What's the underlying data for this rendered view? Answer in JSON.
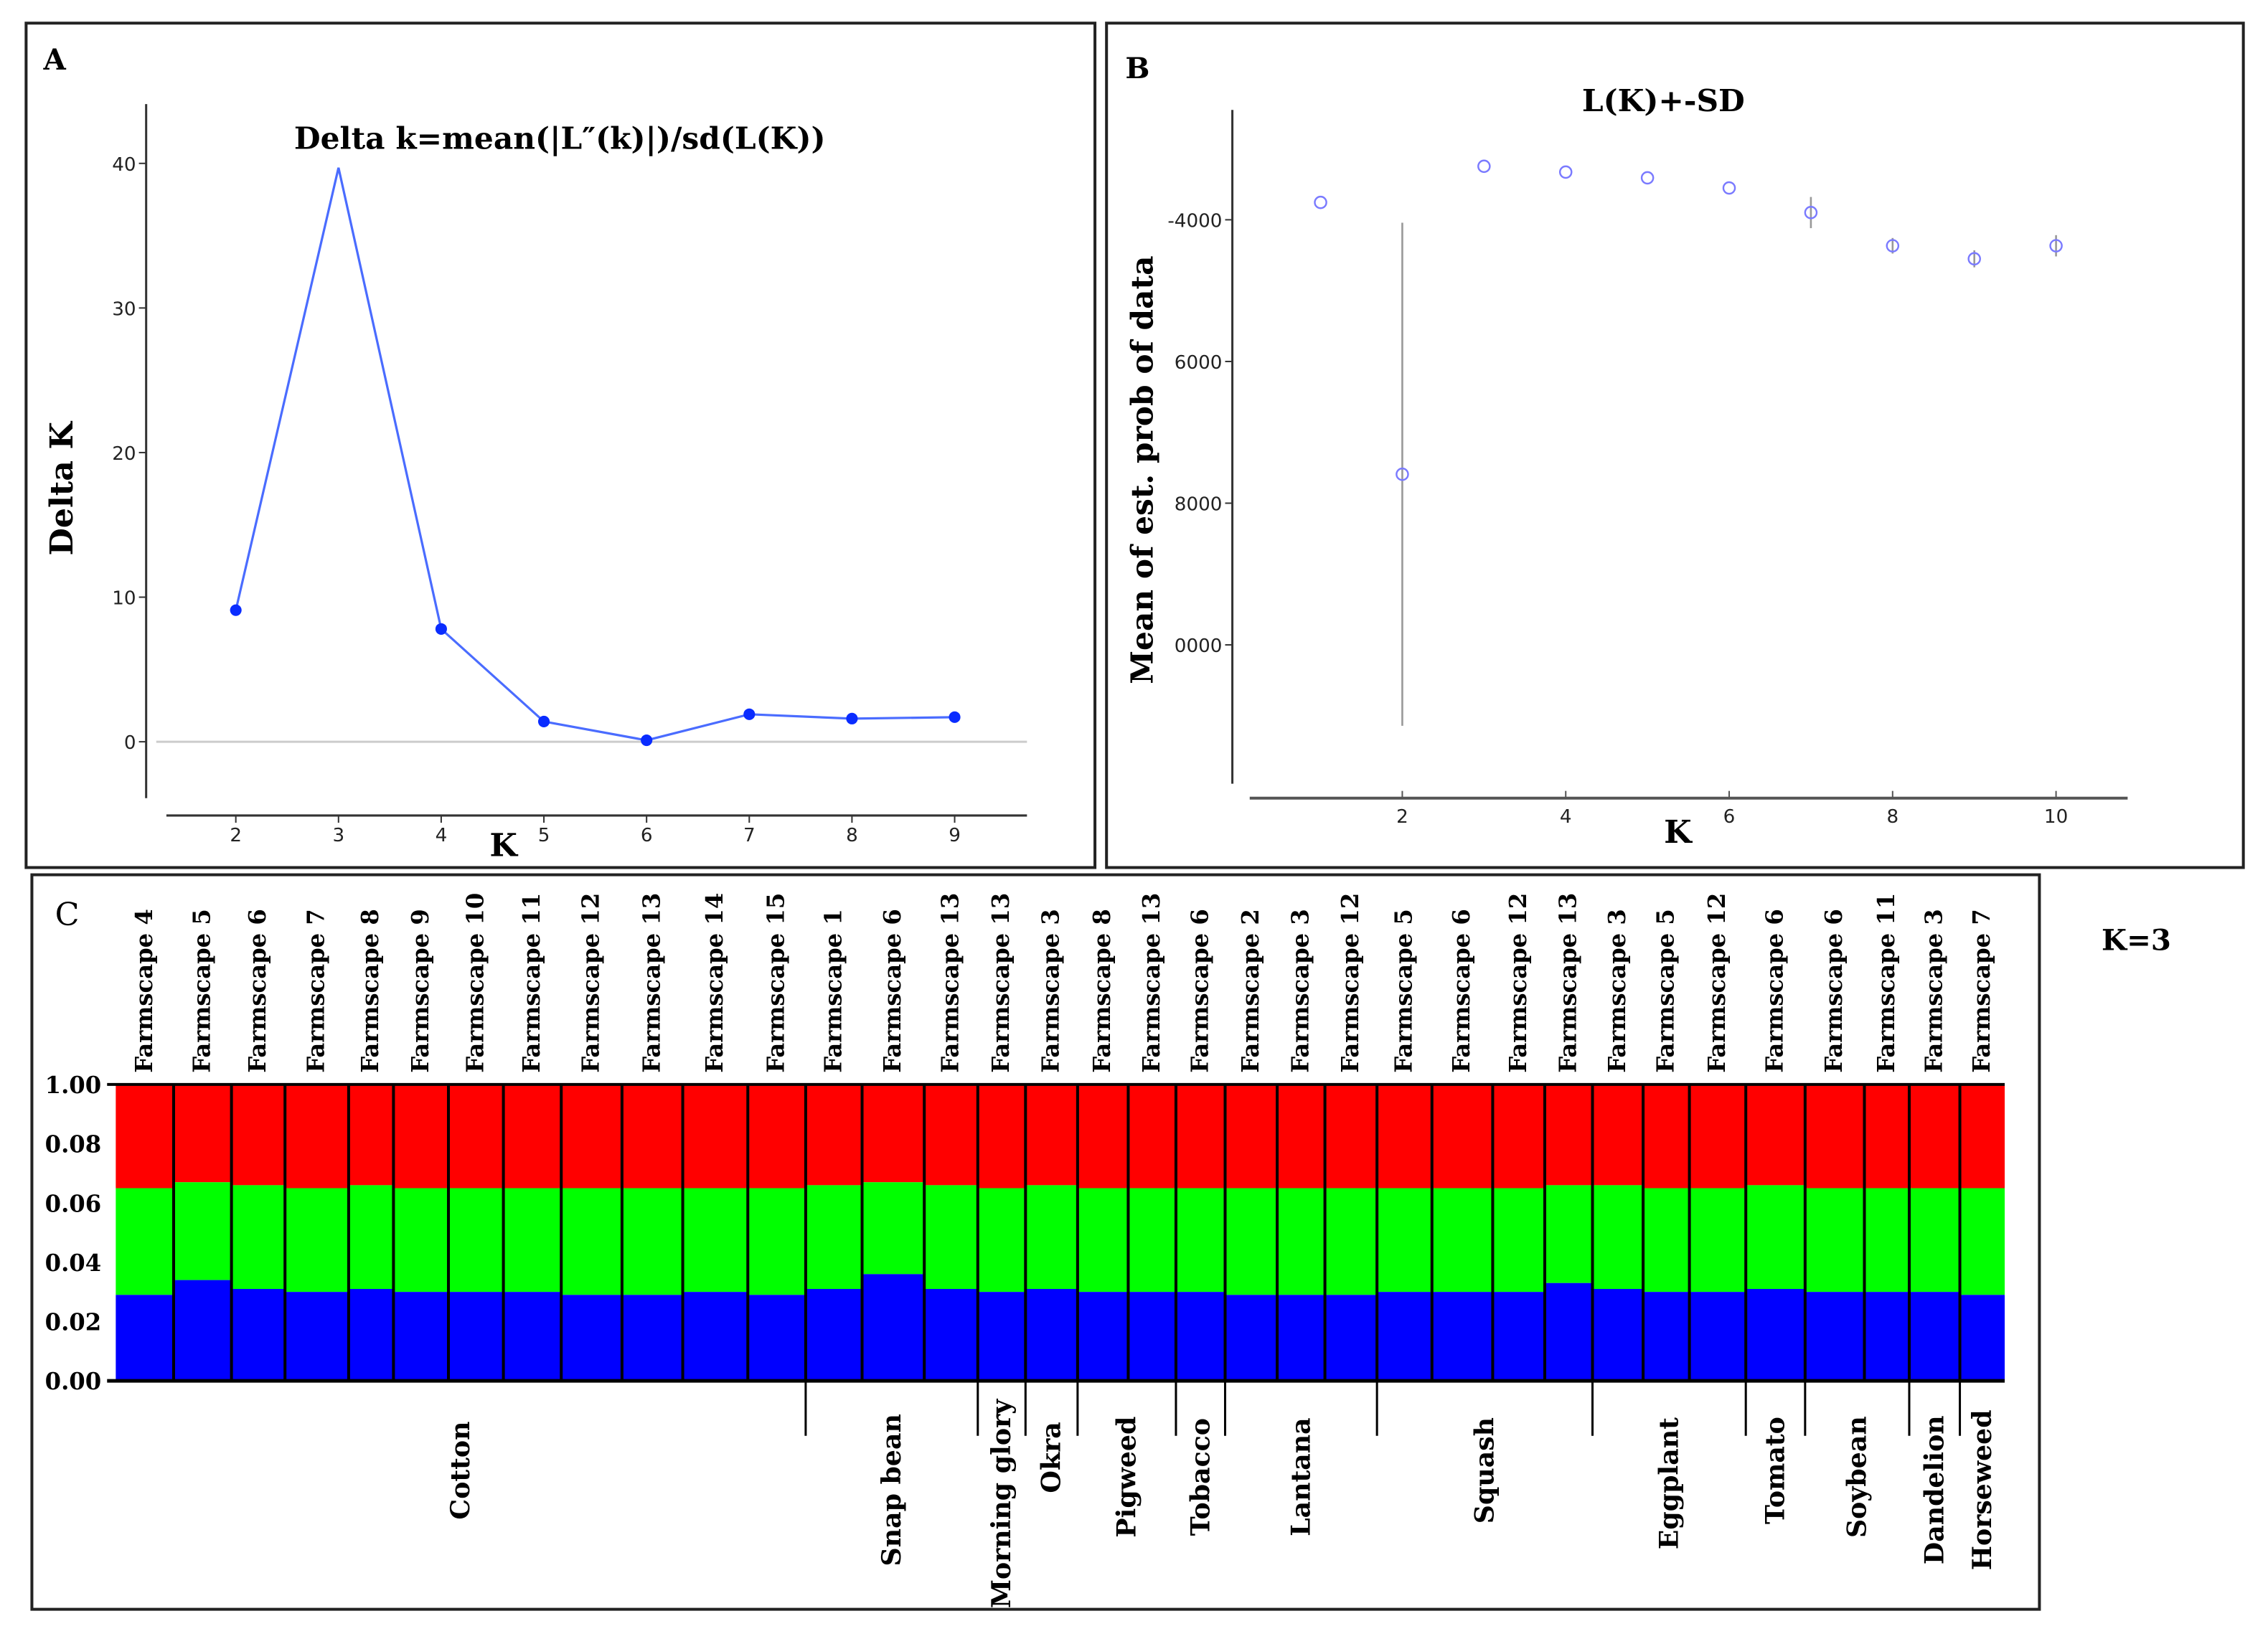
{
  "chart_data": [
    {
      "panel": "A",
      "type": "line",
      "title": "Delta k=mean(|L″(k)|)/sd(L(K))",
      "xlabel": "K",
      "ylabel": "Delta K",
      "x": [
        2,
        3,
        4,
        5,
        6,
        7,
        8,
        9
      ],
      "y": [
        9.1,
        39.7,
        7.8,
        1.4,
        0.1,
        1.9,
        1.6,
        1.7
      ],
      "xticks": [
        "2",
        "3",
        "4",
        "5",
        "6",
        "7",
        "8",
        "9"
      ],
      "yticks": [
        "0",
        "10",
        "20",
        "30",
        "40"
      ],
      "ylim": [
        -4,
        44
      ],
      "series_color": "#0a2cff"
    },
    {
      "panel": "B",
      "type": "scatter",
      "title": "L(K)+-SD",
      "xlabel": "K",
      "ylabel": "Mean of est. prob of data",
      "x": [
        1,
        2,
        3,
        4,
        5,
        6,
        7,
        8,
        9,
        10
      ],
      "y": [
        -3755,
        -7592,
        -3245,
        -3327,
        -3408,
        -3551,
        -3898,
        -4367,
        -4551,
        -4367
      ],
      "sd": [
        0,
        3550,
        0,
        0,
        0,
        0,
        220,
        110,
        120,
        150
      ],
      "xticks": [
        "2",
        "4",
        "6",
        "8",
        "10"
      ],
      "ytick_values": [
        -4000,
        -6000,
        -8000,
        -10000
      ],
      "yticks": [
        "-4000",
        "6000",
        "8000",
        "0000"
      ],
      "ylim": [
        -12000,
        -2500
      ],
      "xlim": [
        0.1,
        10.9
      ],
      "marker_color": "#7a7aff"
    },
    {
      "panel": "C",
      "type": "bar",
      "stacked": true,
      "annotation": "K=3",
      "yticks": [
        "1.00",
        "0.08",
        "0.06",
        "0.04",
        "0.02",
        "0.00"
      ],
      "cluster_colors": [
        "#0000ff",
        "#00ff00",
        "#ff0000"
      ],
      "populations": [
        {
          "label": "Farmscape 4",
          "blue": 0.29,
          "green": 0.36
        },
        {
          "label": "Farmscape 5",
          "blue": 0.34,
          "green": 0.33
        },
        {
          "label": "Farmscape 6",
          "blue": 0.31,
          "green": 0.35
        },
        {
          "label": "Farmscape 7",
          "blue": 0.3,
          "green": 0.35
        },
        {
          "label": "Farmscape 8",
          "blue": 0.31,
          "green": 0.35
        },
        {
          "label": "Farmscape 9",
          "blue": 0.3,
          "green": 0.35
        },
        {
          "label": "Farmscape 10",
          "blue": 0.3,
          "green": 0.35
        },
        {
          "label": "Farmscape 11",
          "blue": 0.3,
          "green": 0.35
        },
        {
          "label": "Farmscape 12",
          "blue": 0.29,
          "green": 0.36
        },
        {
          "label": "Farmscape 13",
          "blue": 0.29,
          "green": 0.36
        },
        {
          "label": "Farmscape 14",
          "blue": 0.3,
          "green": 0.35
        },
        {
          "label": "Farmscape 15",
          "blue": 0.29,
          "green": 0.36
        },
        {
          "label": "Farmscape 1",
          "blue": 0.31,
          "green": 0.35
        },
        {
          "label": "Farmscape  6",
          "blue": 0.36,
          "green": 0.31
        },
        {
          "label": "Farmscape 13",
          "blue": 0.31,
          "green": 0.35
        },
        {
          "label": "Farmscape 13",
          "blue": 0.3,
          "green": 0.35
        },
        {
          "label": "Farmscape 3",
          "blue": 0.31,
          "green": 0.35
        },
        {
          "label": "Farmscape 8",
          "blue": 0.3,
          "green": 0.35
        },
        {
          "label": "Farmscape 13",
          "blue": 0.3,
          "green": 0.35
        },
        {
          "label": "Farmscape 6",
          "blue": 0.3,
          "green": 0.35
        },
        {
          "label": "Farmscape 2",
          "blue": 0.29,
          "green": 0.36
        },
        {
          "label": "Farmscape 3",
          "blue": 0.29,
          "green": 0.36
        },
        {
          "label": "Farmscape 12",
          "blue": 0.29,
          "green": 0.36
        },
        {
          "label": "Farmscape 5",
          "blue": 0.3,
          "green": 0.35
        },
        {
          "label": "Farmscape 6",
          "blue": 0.3,
          "green": 0.35
        },
        {
          "label": "Farmscape 12",
          "blue": 0.3,
          "green": 0.35
        },
        {
          "label": "Farmscape 13",
          "blue": 0.33,
          "green": 0.33
        },
        {
          "label": "Farmscape 3",
          "blue": 0.31,
          "green": 0.35
        },
        {
          "label": "Farmscape 5",
          "blue": 0.3,
          "green": 0.35
        },
        {
          "label": "Farmscape 12",
          "blue": 0.3,
          "green": 0.35
        },
        {
          "label": "Farmscape 6",
          "blue": 0.31,
          "green": 0.35
        },
        {
          "label": "Farmscape 6",
          "blue": 0.3,
          "green": 0.35
        },
        {
          "label": "Farmscape 11",
          "blue": 0.3,
          "green": 0.35
        },
        {
          "label": "Farmscape 3",
          "blue": 0.3,
          "green": 0.35
        },
        {
          "label": "Farmscape 7",
          "blue": 0.29,
          "green": 0.36
        }
      ],
      "hosts": [
        {
          "label": "Cotton",
          "count": 12
        },
        {
          "label": "Snap bean",
          "count": 3
        },
        {
          "label": "Morning glory",
          "count": 1
        },
        {
          "label": "Okra",
          "count": 1
        },
        {
          "label": "Pigweed",
          "count": 2
        },
        {
          "label": "Tobacco",
          "count": 1
        },
        {
          "label": "Lantana",
          "count": 3
        },
        {
          "label": "Squash",
          "count": 4
        },
        {
          "label": "Eggplant",
          "count": 3
        },
        {
          "label": "Tomato",
          "count": 1
        },
        {
          "label": "Soybean",
          "count": 2
        },
        {
          "label": "Dandelion",
          "count": 1
        },
        {
          "label": "Horseweed",
          "count": 1
        }
      ]
    }
  ],
  "panels": {
    "a": "A",
    "b": "B",
    "c": "C"
  }
}
